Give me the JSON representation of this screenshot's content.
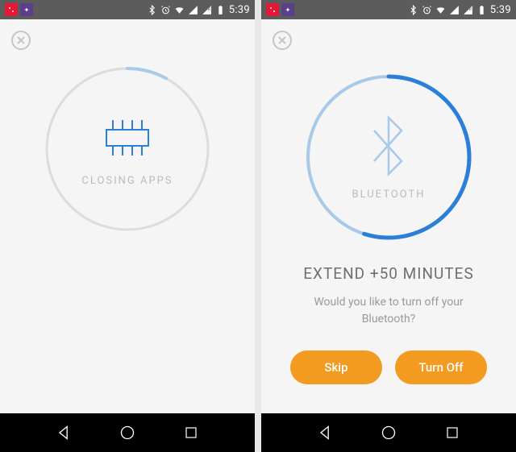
{
  "status": {
    "time": "5:39"
  },
  "left": {
    "circle_label": "CLOSING APPS",
    "progress_percent": 8
  },
  "right": {
    "circle_label": "BLUETOOTH",
    "progress_percent": 55,
    "headline": "EXTEND +50 MINUTES",
    "subtext": "Would you like to turn off your Bluetooth?",
    "skip_label": "Skip",
    "turnoff_label": "Turn Off"
  },
  "colors": {
    "accent": "#2b7fd9",
    "accent_light": "#a9c9e8",
    "ring_bg": "#dcdcdc",
    "button": "#f39a21"
  }
}
